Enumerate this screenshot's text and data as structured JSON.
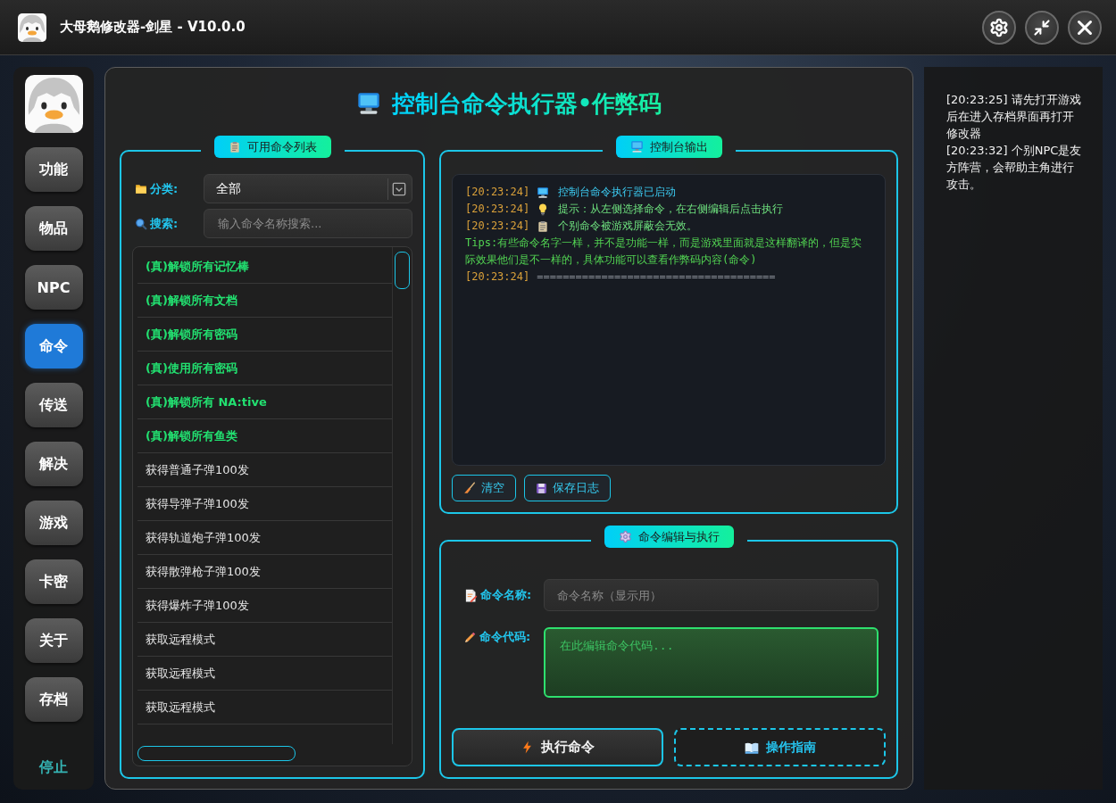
{
  "window": {
    "title": "大母鹅修改器-剑星 - V10.0.0"
  },
  "sidebar": {
    "items": [
      {
        "label": "功能",
        "selected": false
      },
      {
        "label": "物品",
        "selected": false
      },
      {
        "label": "NPC",
        "selected": false
      },
      {
        "label": "命令",
        "selected": true
      },
      {
        "label": "传送",
        "selected": false
      },
      {
        "label": "解决",
        "selected": false
      },
      {
        "label": "游戏",
        "selected": false
      },
      {
        "label": "卡密",
        "selected": false
      },
      {
        "label": "关于",
        "selected": false
      },
      {
        "label": "存档",
        "selected": false
      }
    ],
    "stop_label": "停止"
  },
  "main": {
    "title": "控制台命令执行器•作弊码"
  },
  "command_list": {
    "legend": "可用命令列表",
    "category": {
      "label": "分类:",
      "value": "全部"
    },
    "search": {
      "label": "搜索:",
      "placeholder": "输入命令名称搜索..."
    },
    "items": [
      {
        "label": "(真)解锁所有记忆棒",
        "kind": "highlight"
      },
      {
        "label": "(真)解锁所有文档",
        "kind": "highlight"
      },
      {
        "label": "(真)解锁所有密码",
        "kind": "highlight"
      },
      {
        "label": "(真)使用所有密码",
        "kind": "highlight"
      },
      {
        "label": "(真)解锁所有 NA:tive",
        "kind": "highlight"
      },
      {
        "label": "(真)解锁所有鱼类",
        "kind": "highlight"
      },
      {
        "label": "获得普通子弹100发",
        "kind": "plain"
      },
      {
        "label": "获得导弹子弹100发",
        "kind": "plain"
      },
      {
        "label": "获得轨道炮子弹100发",
        "kind": "plain"
      },
      {
        "label": "获得散弹枪子弹100发",
        "kind": "plain"
      },
      {
        "label": "获得爆炸子弹100发",
        "kind": "plain"
      },
      {
        "label": "获取远程模式",
        "kind": "plain"
      },
      {
        "label": "获取远程模式",
        "kind": "plain"
      },
      {
        "label": "获取远程模式",
        "kind": "plain"
      }
    ]
  },
  "console": {
    "legend": "控制台输出",
    "lines": [
      {
        "kind": "start",
        "time": "[20:23:24]",
        "text": "控制台命令执行器已启动"
      },
      {
        "kind": "hint",
        "time": "[20:23:24]",
        "text": "提示：从左侧选择命令，在右侧编辑后点击执行"
      },
      {
        "kind": "notice",
        "time": "[20:23:24]",
        "text": "个别命令被游戏屏蔽会无效。"
      },
      {
        "kind": "tips",
        "text": "Tips:有些命令名字一样，并不是功能一样，而是游戏里面就是这样翻译的，但是实际效果他们是不一样的，具体功能可以查看作弊码内容(命令)"
      },
      {
        "kind": "separator",
        "time": "[20:23:24]",
        "text": "====================================="
      }
    ],
    "buttons": [
      {
        "kind": "clear",
        "label": "清空"
      },
      {
        "kind": "save",
        "label": "保存日志"
      }
    ]
  },
  "editor": {
    "legend": "命令编辑与执行",
    "name_field": {
      "label": "命令名称:",
      "placeholder": "命令名称（显示用）"
    },
    "code_field": {
      "label": "命令代码:",
      "placeholder": "在此编辑命令代码..."
    },
    "buttons": [
      {
        "kind": "execute",
        "label": "执行命令"
      },
      {
        "kind": "guide",
        "label": "操作指南"
      }
    ]
  },
  "notifications": [
    {
      "text": "[20:23:25] 请先打开游戏后在进入存档界面再打开修改器"
    },
    {
      "text": "[20:23:32] 个别NPC是友方阵营，会帮助主角进行攻击。"
    }
  ]
}
